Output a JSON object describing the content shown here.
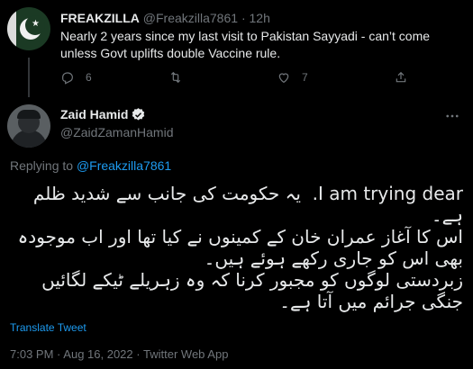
{
  "parent_tweet": {
    "display_name": "FREAKZILLA",
    "handle": "@Freakzilla7861",
    "separator": "·",
    "time": "12h",
    "text": "Nearly 2 years since my last visit to Pakistan Sayyadi - can’t come unless Govt uplifts double Vaccine rule.",
    "reply_count": "6",
    "like_count": "7"
  },
  "main_tweet": {
    "display_name": "Zaid Hamid",
    "handle": "@ZaidZamanHamid",
    "replying_label": "Replying to",
    "replying_handle": "@Freakzilla7861",
    "text": "I am trying dear.  یہ حکومت کی جانب سے شدید ظلم ہے۔\nاس کا آغاز عمران خان کے کمینوں نے کیا تھا اور اب موجودہ بھی اس کو جاری رکھے ہوئے ہیں۔\nزبردستی لوگوں کو مجبور کرنا کہ وہ زہریلے ٹیکے لگائیں جنگی جرائم میں آتا ہے۔",
    "translate_label": "Translate Tweet",
    "time": "7:03 PM",
    "date": "Aug 16, 2022",
    "source": "Twitter Web App",
    "separator": "·"
  },
  "colors": {
    "background": "#000000",
    "text": "#e7e9ea",
    "muted": "#71767b",
    "link": "#1d9bf0",
    "verified": "#1d9bf0"
  },
  "icons": {
    "reply": "reply-icon",
    "retweet": "retweet-icon",
    "like": "heart-icon",
    "share": "share-icon",
    "verified": "verified-badge-icon",
    "more": "more-options-icon"
  }
}
